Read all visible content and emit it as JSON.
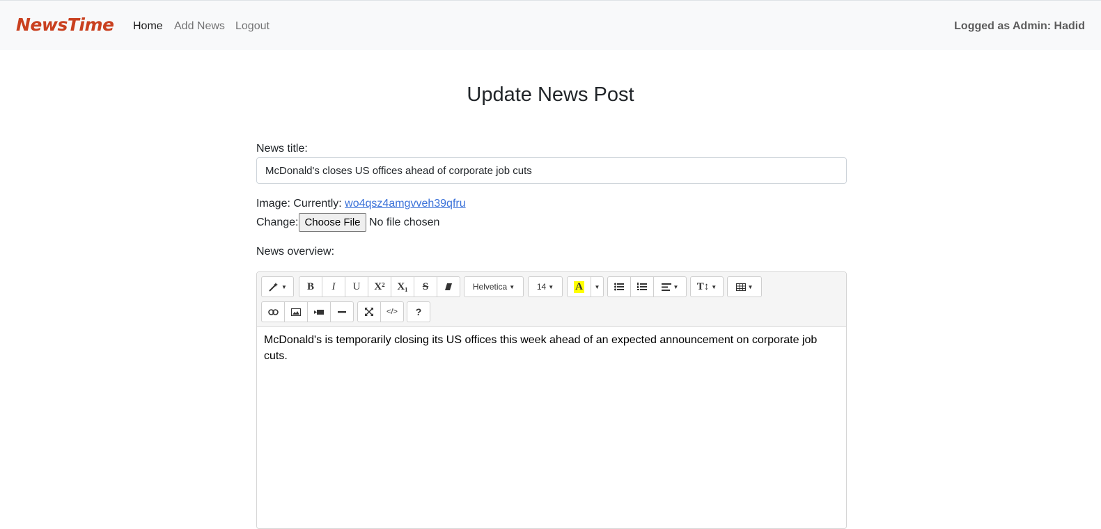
{
  "navbar": {
    "brand": "NewsTime",
    "links": [
      "Home",
      "Add News",
      "Logout"
    ],
    "user": "Logged as Admin: Hadid"
  },
  "page": {
    "title": "Update News Post"
  },
  "form": {
    "title_label": "News title:",
    "title_value": "McDonald's closes US offices ahead of corporate job cuts",
    "image_label": "Image: Currently:",
    "image_current": "wo4qsz4amgvveh39qfru",
    "change_label": "Change:",
    "file_button": "Choose File",
    "file_status": "No file chosen",
    "overview_label": "News overview:"
  },
  "editor": {
    "toolbar": {
      "font_family": "Helvetica",
      "font_size": "14",
      "bold": "B",
      "italic": "I",
      "underline": "U",
      "superscript": "X²",
      "subscript": "X₁",
      "strikethrough": "S",
      "color": "A",
      "code": "</>",
      "help": "?",
      "highlight_color": "#ffff00"
    },
    "content": "McDonald's is temporarily closing its US offices this week ahead of an expected announcement on corporate job cuts."
  },
  "colors": {
    "brand": "#c9401f",
    "link": "#3b72d9",
    "navbar_bg": "#f8f9fa"
  }
}
